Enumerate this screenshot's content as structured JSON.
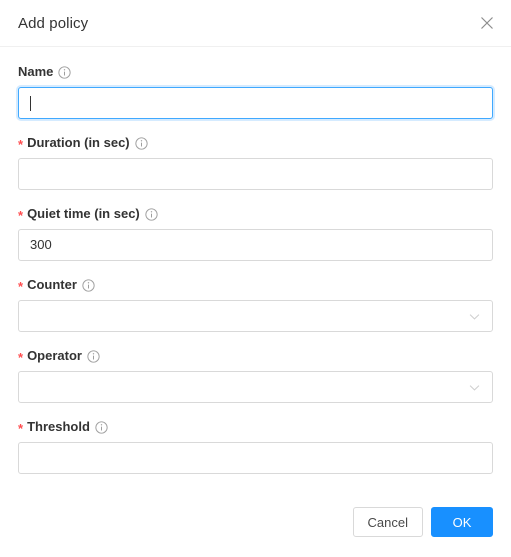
{
  "dialog": {
    "title": "Add policy",
    "close_icon": "close-icon"
  },
  "colors": {
    "accent": "#1890ff",
    "focus_border": "#40a9ff",
    "required_asterisk": "#ff4d4f",
    "border": "#d9d9d9",
    "label_text": "#333333",
    "divider": "#f0f0f0",
    "background": "#ffffff"
  },
  "fields": [
    {
      "key": "name",
      "label": "Name",
      "required": false,
      "required_marker": "",
      "info_icon": "info-circle-icon",
      "type": "text",
      "value": "",
      "placeholder": "",
      "focused": true
    },
    {
      "key": "duration",
      "label": "Duration (in sec)",
      "required": true,
      "required_marker": "*",
      "info_icon": "info-circle-icon",
      "type": "text",
      "value": "",
      "placeholder": "",
      "focused": false
    },
    {
      "key": "quiet_time",
      "label": "Quiet time (in sec)",
      "required": true,
      "required_marker": "*",
      "info_icon": "info-circle-icon",
      "type": "text",
      "value": "300",
      "placeholder": "",
      "focused": false
    },
    {
      "key": "counter",
      "label": "Counter",
      "required": true,
      "required_marker": "*",
      "info_icon": "info-circle-icon",
      "type": "select",
      "value": "",
      "placeholder": "",
      "dropdown_icon": "chevron-down-icon",
      "focused": false
    },
    {
      "key": "operator",
      "label": "Operator",
      "required": true,
      "required_marker": "*",
      "info_icon": "info-circle-icon",
      "type": "select",
      "value": "",
      "placeholder": "",
      "dropdown_icon": "chevron-down-icon",
      "focused": false
    },
    {
      "key": "threshold",
      "label": "Threshold",
      "required": true,
      "required_marker": "*",
      "info_icon": "info-circle-icon",
      "type": "text",
      "value": "",
      "placeholder": "",
      "focused": false
    }
  ],
  "footer": {
    "cancel_label": "Cancel",
    "ok_label": "OK"
  }
}
